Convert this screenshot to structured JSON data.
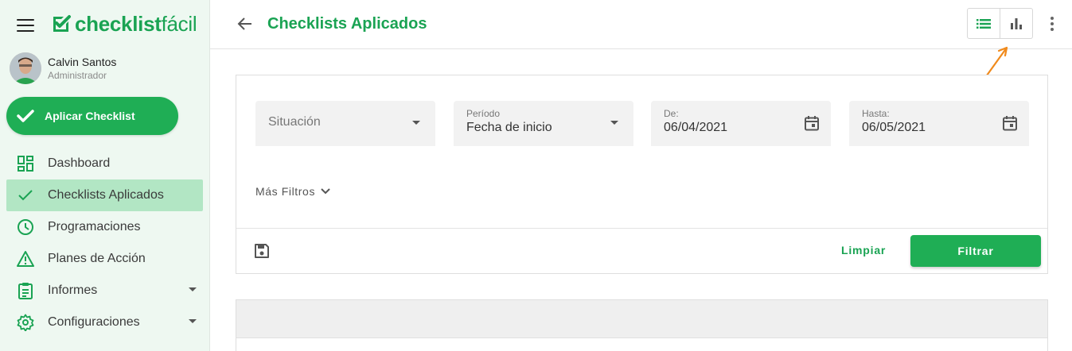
{
  "brand": {
    "name_bold": "checklist",
    "name_light": "fácil",
    "color": "#1aa353"
  },
  "user": {
    "name": "Calvin Santos",
    "role": "Administrador"
  },
  "sidebar": {
    "apply_button": "Aplicar Checklist",
    "items": [
      {
        "label": "Dashboard",
        "icon": "dashboard-icon",
        "active": false
      },
      {
        "label": "Checklists Aplicados",
        "icon": "check-icon",
        "active": true
      },
      {
        "label": "Programaciones",
        "icon": "clock-icon",
        "active": false
      },
      {
        "label": "Planes de Acción",
        "icon": "warning-icon",
        "active": false
      },
      {
        "label": "Informes",
        "icon": "report-icon",
        "active": false,
        "expandable": true
      },
      {
        "label": "Configuraciones",
        "icon": "gear-icon",
        "active": false,
        "expandable": true
      }
    ]
  },
  "header": {
    "title": "Checklists Aplicados"
  },
  "filters": {
    "situacion": {
      "placeholder": "Situación"
    },
    "periodo": {
      "label": "Período",
      "value": "Fecha de inicio"
    },
    "desde": {
      "label": "De:",
      "value": "06/04/2021"
    },
    "hasta": {
      "label": "Hasta:",
      "value": "06/05/2021"
    },
    "more_filters": "Más Filtros",
    "clear": "Limpiar",
    "apply": "Filtrar"
  },
  "colors": {
    "accent": "#1fae55",
    "active_nav": "#b2e6c4",
    "sidebar_bg": "#eef8f1",
    "annotation": "#f08a1c"
  }
}
